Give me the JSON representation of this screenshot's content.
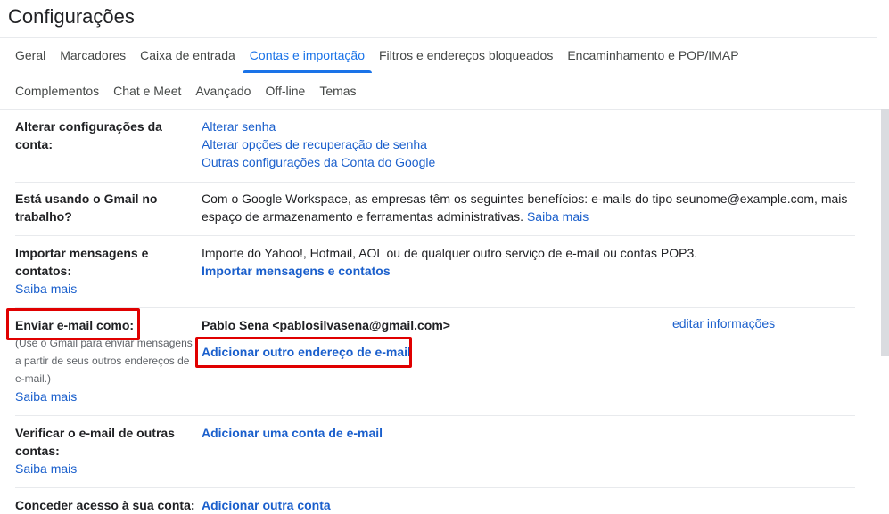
{
  "page": {
    "title": "Configurações"
  },
  "tabs": {
    "row1": [
      "Geral",
      "Marcadores",
      "Caixa de entrada",
      "Contas e importação",
      "Filtros e endereços bloqueados",
      "Encaminhamento e POP/IMAP"
    ],
    "row2": [
      "Complementos",
      "Chat e Meet",
      "Avançado",
      "Off-line",
      "Temas"
    ],
    "active": "Contas e importação"
  },
  "sections": {
    "change_account": {
      "label": "Alterar configurações da conta:",
      "links": [
        "Alterar senha",
        "Alterar opções de recuperação de senha",
        "Outras configurações da Conta do Google"
      ]
    },
    "work": {
      "label": "Está usando o Gmail no trabalho?",
      "text": "Com o Google Workspace, as empresas têm os seguintes benefícios: e-mails do tipo seunome@example.com, mais espaço de armazenamento e ferramentas administrativas.",
      "link": "Saiba mais"
    },
    "import": {
      "label": "Importar mensagens e contatos:",
      "learn_more": "Saiba mais",
      "text": "Importe do Yahoo!, Hotmail, AOL ou de qualquer outro serviço de e-mail ou contas POP3.",
      "action": "Importar mensagens e contatos"
    },
    "send_as": {
      "label": "Enviar e-mail como:",
      "note": "(Use o Gmail para enviar mensagens a partir de seus outros endereços de e-mail.)",
      "learn_more": "Saiba mais",
      "address": "Pablo Sena <pablosilvasena@gmail.com>",
      "edit": "editar informações",
      "action": "Adicionar outro endereço de e-mail"
    },
    "check_mail": {
      "label": "Verificar o e-mail de outras contas:",
      "learn_more": "Saiba mais",
      "action": "Adicionar uma conta de e-mail"
    },
    "grant_access": {
      "label": "Conceder acesso à sua conta:",
      "action": "Adicionar outra conta"
    }
  },
  "colors": {
    "accent": "#1a73e8",
    "link": "#1a5fcc",
    "highlight": "#e00000"
  }
}
